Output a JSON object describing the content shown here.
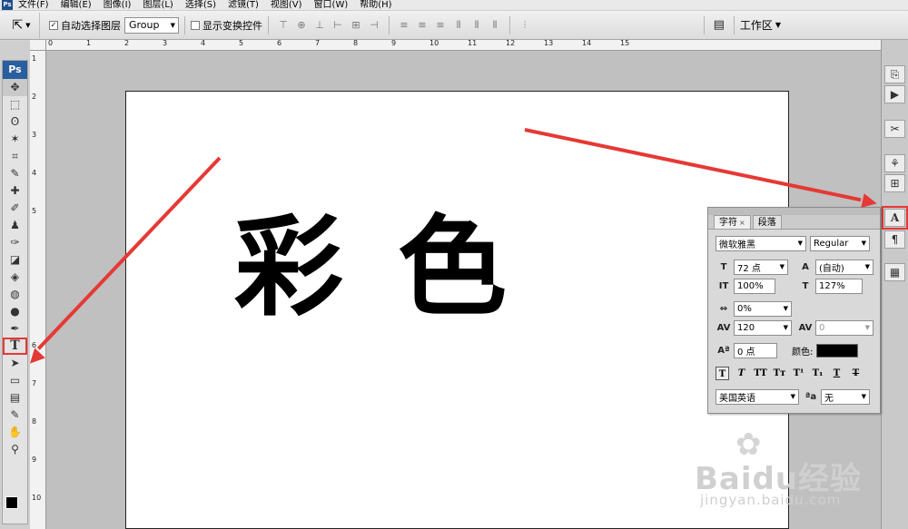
{
  "menubar": {
    "items": [
      "文件(F)",
      "编辑(E)",
      "图像(I)",
      "图层(L)",
      "选择(S)",
      "滤镜(T)",
      "视图(V)",
      "窗口(W)",
      "帮助(H)"
    ]
  },
  "options": {
    "auto_select_label": "自动选择图层",
    "auto_select_checked": true,
    "auto_select_value": "Group",
    "show_transform_label": "显示变换控件",
    "show_transform_checked": false,
    "workspace_label": "工作区"
  },
  "toolbox": {
    "logo": "Ps"
  },
  "rulers": {
    "top": [
      "0",
      "1",
      "2",
      "3",
      "4",
      "5",
      "6",
      "7",
      "8",
      "9",
      "10",
      "11",
      "12",
      "13",
      "14",
      "15"
    ],
    "left": [
      "1",
      "2",
      "3",
      "4",
      "5",
      "6",
      "7",
      "8",
      "9",
      "10"
    ]
  },
  "canvas": {
    "text": "彩色"
  },
  "character_panel": {
    "tab_character": "字符",
    "tab_paragraph": "段落",
    "font_family": "微软雅黑",
    "font_style": "Regular",
    "font_size": "72 点",
    "leading": "(自动)",
    "vertical_scale": "100%",
    "horizontal_scale": "127%",
    "kerning": "0%",
    "tracking": "120",
    "kerning_pair": "0",
    "baseline_shift": "0 点",
    "color_label": "颜色:",
    "color_value": "#000000",
    "language": "美国英语",
    "antialias": "无"
  },
  "watermark": {
    "brand": "Baidu经验",
    "url": "jingyan.baidu.com"
  },
  "colors": {
    "annotation": "#e53935",
    "ps_blue": "#2a5e9e"
  }
}
